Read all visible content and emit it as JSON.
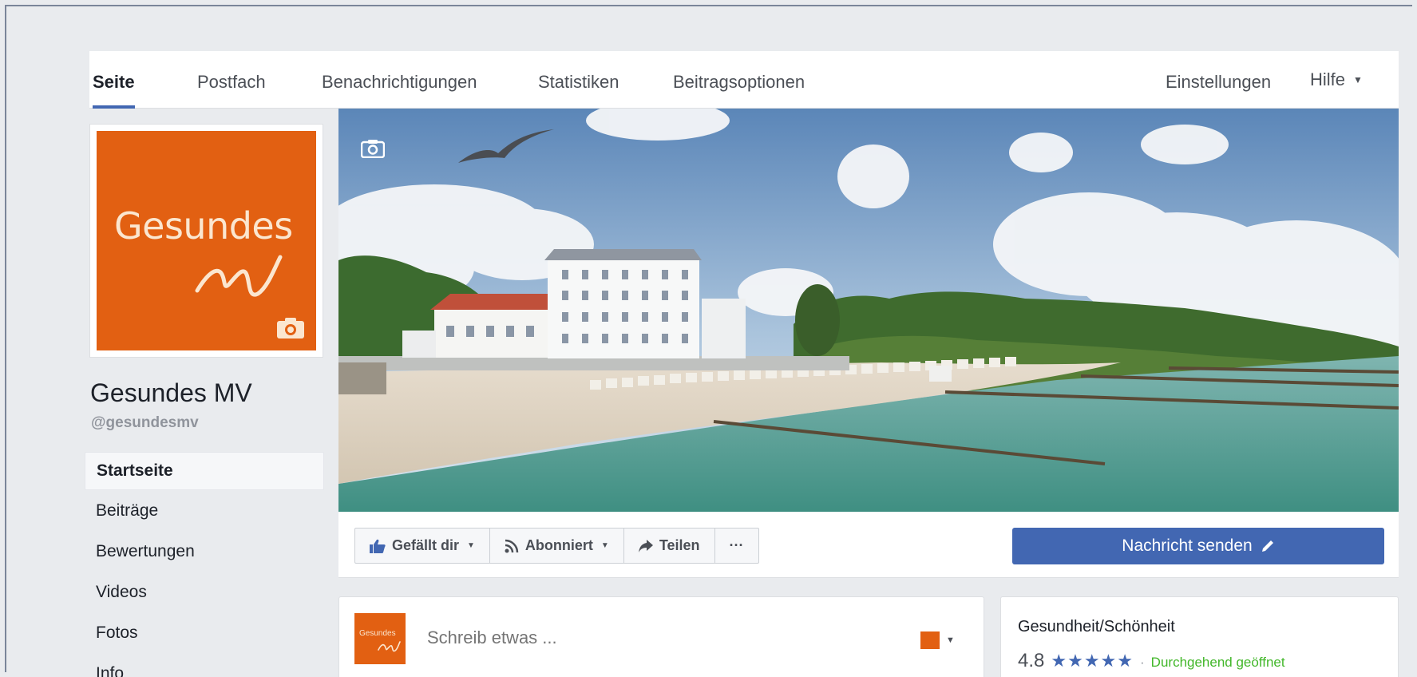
{
  "topnav": {
    "tabs": [
      {
        "label": "Seite",
        "active": true
      },
      {
        "label": "Postfach"
      },
      {
        "label": "Benachrichtigungen"
      },
      {
        "label": "Statistiken"
      },
      {
        "label": "Beitragsoptionen"
      }
    ],
    "settings_label": "Einstellungen",
    "help_label": "Hilfe"
  },
  "profile": {
    "logo_word": "Gesundes",
    "logo_mark": "MV",
    "name": "Gesundes MV",
    "handle": "@gesundesmv"
  },
  "leftnav": {
    "items": [
      {
        "label": "Startseite",
        "active": true
      },
      {
        "label": "Beiträge"
      },
      {
        "label": "Bewertungen"
      },
      {
        "label": "Videos"
      },
      {
        "label": "Fotos"
      },
      {
        "label": "Info"
      }
    ]
  },
  "actions": {
    "like_label": "Gefällt dir",
    "follow_label": "Abonniert",
    "share_label": "Teilen",
    "more_label": "···",
    "message_label": "Nachricht senden"
  },
  "composer": {
    "placeholder": "Schreib etwas ...",
    "avatar_word": "Gesundes"
  },
  "about": {
    "category": "Gesundheit/Schönheit",
    "rating": "4.8",
    "stars": "★★★★★",
    "separator": "·",
    "open_status": "Durchgehend geöffnet"
  },
  "colors": {
    "brand_orange": "#e26012",
    "facebook_blue": "#4267b2",
    "open_green": "#42b72a",
    "page_bg": "#e9ebee"
  },
  "icons": {
    "camera": "camera-icon",
    "like": "thumbs-up-icon",
    "follow": "rss-icon",
    "share": "share-arrow-icon",
    "message_edit": "pencil-icon",
    "dropdown": "chevron-down-icon"
  }
}
